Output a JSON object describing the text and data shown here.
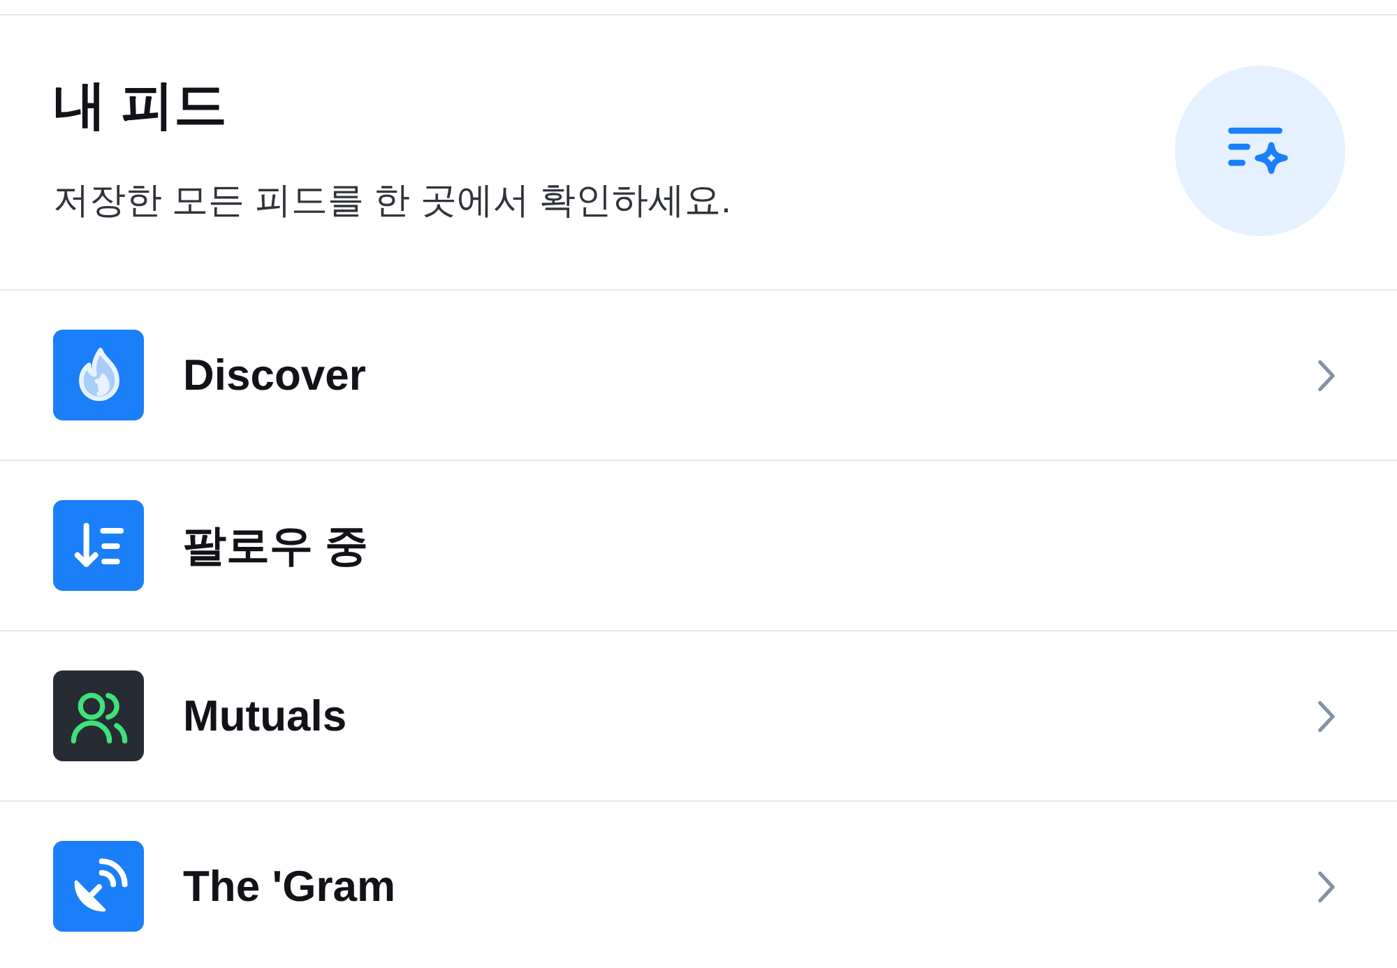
{
  "header": {
    "title": "내 피드",
    "subtitle": "저장한 모든 피드를 한 곳에서 확인하세요."
  },
  "feeds": [
    {
      "kind": "flame",
      "color": "#1a7ff8",
      "label": "Discover",
      "chevron": true
    },
    {
      "kind": "sort",
      "color": "#1a7ff8",
      "label": "팔로우 중",
      "chevron": false
    },
    {
      "kind": "people",
      "color": "#272b33",
      "label": "Mutuals",
      "chevron": true
    },
    {
      "kind": "antenna",
      "color": "#1a7ff8",
      "label": "The 'Gram",
      "chevron": true
    }
  ]
}
